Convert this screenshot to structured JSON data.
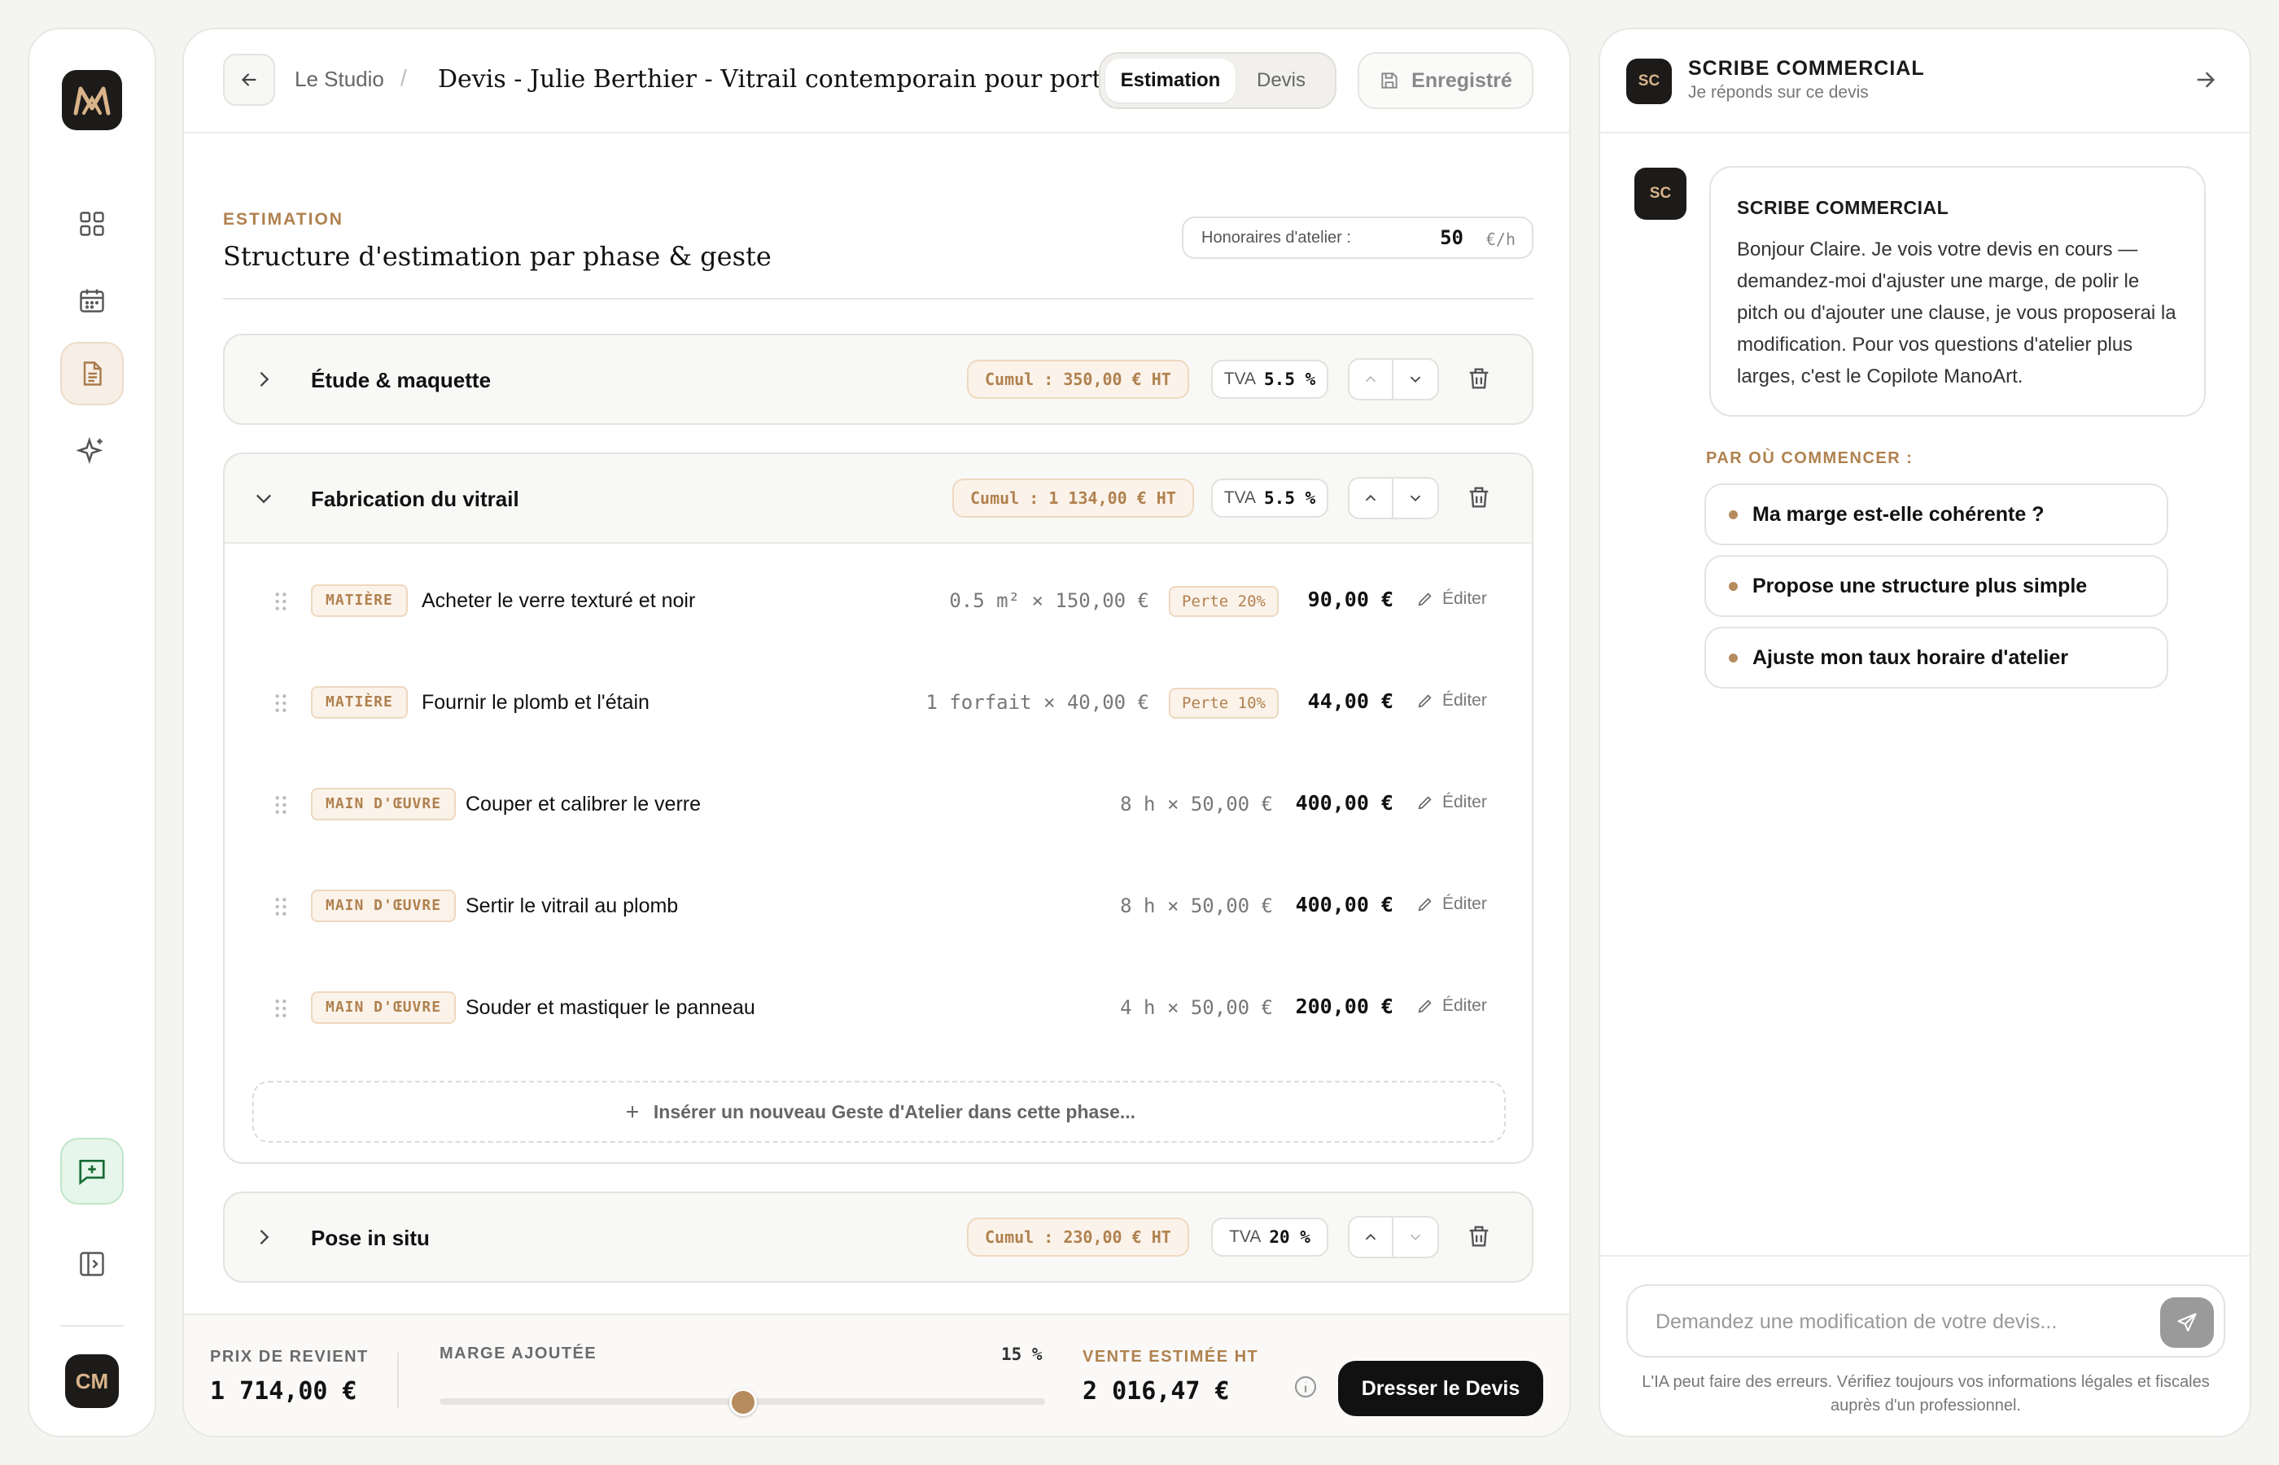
{
  "sidebar": {
    "logo": "M-logo",
    "nav_icons": [
      "grid-icon",
      "calendar-icon",
      "document-icon",
      "sparkle-icon"
    ],
    "chat_icon": "chat-plus-icon",
    "collapse_icon": "sidebar-collapse-icon",
    "avatar": "CM"
  },
  "header": {
    "breadcrumb": "Le Studio",
    "separator": "/",
    "title": "Devis - Julie Berthier - Vitrail contemporain pour porte",
    "tabs": [
      "Estimation",
      "Devis"
    ],
    "save_label": "Enregistré"
  },
  "section": {
    "kicker": "ESTIMATION",
    "title": "Structure d'estimation par phase & geste",
    "rate_label": "Honoraires d'atelier :",
    "rate_value": "50",
    "rate_unit": "€/h"
  },
  "phases": [
    {
      "name": "Étude & maquette",
      "cumul": "Cumul : 350,00 € HT",
      "tva_label": "TVA",
      "tva": "5.5 %"
    },
    {
      "name": "Fabrication du vitrail",
      "cumul": "Cumul : 1 134,00 € HT",
      "tva_label": "TVA",
      "tva": "5.5 %"
    },
    {
      "name": "Pose in situ",
      "cumul": "Cumul : 230,00 € HT",
      "tva_label": "TVA",
      "tva": "20 %"
    }
  ],
  "items": [
    {
      "tag": "MATIÈRE",
      "name": "Acheter le verre texturé et noir",
      "qty": "0.5 m² × 150,00 €",
      "perte": "Perte 20%",
      "price": "90,00 €",
      "edit": "Éditer"
    },
    {
      "tag": "MATIÈRE",
      "name": "Fournir le plomb et l'étain",
      "qty": "1 forfait × 40,00 €",
      "perte": "Perte 10%",
      "price": "44,00 €",
      "edit": "Éditer"
    },
    {
      "tag": "MAIN D'ŒUVRE",
      "name": "Couper et calibrer le verre",
      "qty": "8 h × 50,00 €",
      "price": "400,00 €",
      "edit": "Éditer"
    },
    {
      "tag": "MAIN D'ŒUVRE",
      "name": "Sertir le vitrail au plomb",
      "qty": "8 h × 50,00 €",
      "price": "400,00 €",
      "edit": "Éditer"
    },
    {
      "tag": "MAIN D'ŒUVRE",
      "name": "Souder et mastiquer le panneau",
      "qty": "4 h × 50,00 €",
      "price": "200,00 €",
      "edit": "Éditer"
    }
  ],
  "insert_label": "Insérer un nouveau Geste d'Atelier dans cette phase...",
  "footer": {
    "cost_label": "PRIX DE REVIENT",
    "cost_value": "1 714,00 €",
    "margin_label": "MARGE AJOUTÉE",
    "margin_pct": "15 %",
    "margin_fraction": 0.15,
    "sale_label": "VENTE ESTIMÉE HT",
    "sale_value": "2 016,47 €",
    "cta": "Dresser le Devis"
  },
  "assistant": {
    "initials": "SC",
    "name": "SCRIBE COMMERCIAL",
    "subtitle": "Je réponds sur ce devis",
    "message": "Bonjour Claire. Je vois votre devis en cours — demandez-moi d'ajuster une marge, de polir le pitch ou d'ajouter une clause, je vous proposerai la modification. Pour vos questions d'atelier plus larges, c'est le Copilote ManoArt.",
    "start_label": "PAR OÙ COMMENCER :",
    "suggestions": [
      "Ma marge est-elle cohérente ?",
      "Propose une structure plus simple",
      "Ajuste mon taux horaire d'atelier"
    ],
    "placeholder": "Demandez une modification de votre devis...",
    "disclaimer": "L'IA peut faire des erreurs. Vérifiez toujours vos informations légales et fiscales auprès d'un professionnel."
  },
  "colors": {
    "accent": "#b0814f",
    "dark": "#1c1b19",
    "green_bg": "#e6f6ea"
  }
}
